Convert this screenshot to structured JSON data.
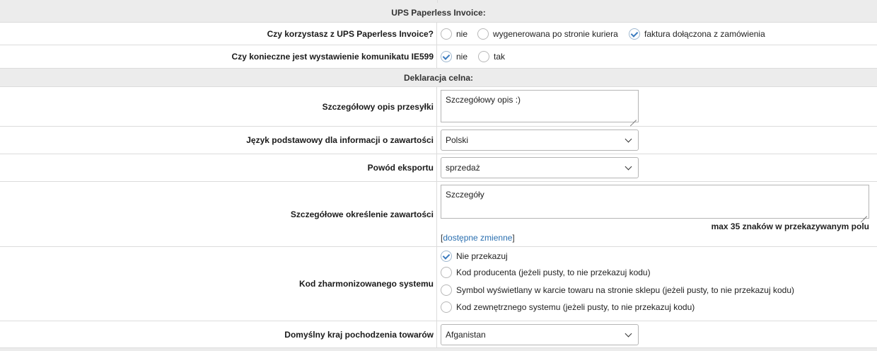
{
  "sections": {
    "ups_paperless": "UPS Paperless Invoice:",
    "customs": "Deklaracja celna:"
  },
  "paperless_invoice": {
    "label": "Czy korzystasz z UPS Paperless Invoice?",
    "options": [
      "nie",
      "wygenerowana po stronie kuriera",
      "faktura dołączona z zamówienia"
    ],
    "selected": "faktura dołączona z zamówienia"
  },
  "ie599": {
    "label": "Czy konieczne jest wystawienie komunikatu IE599",
    "options": [
      "nie",
      "tak"
    ],
    "selected": "nie"
  },
  "shipment_description": {
    "label": "Szczegółowy opis przesyłki",
    "value": "Szczegółowy opis :)"
  },
  "language": {
    "label": "Język podstawowy dla informacji o zawartości",
    "value": "Polski"
  },
  "export_reason": {
    "label": "Powód eksportu",
    "value": "sprzedaż"
  },
  "content_details": {
    "label": "Szczegółowe określenie zawartości",
    "value": "Szczegóły",
    "hint": "max 35 znaków w przekazywanym polu",
    "vars_open": "[",
    "vars_link": "dostępne zmienne",
    "vars_close": "]"
  },
  "hs_code": {
    "label": "Kod zharmonizowanego systemu",
    "options": [
      "Nie przekazuj",
      "Kod producenta (jeżeli pusty, to nie przekazuj kodu)",
      "Symbol wyświetlany w karcie towaru na stronie sklepu (jeżeli pusty, to nie przekazuj kodu)",
      "Kod zewnętrznego systemu (jeżeli pusty, to nie przekazuj kodu)"
    ],
    "selected": "Nie przekazuj"
  },
  "origin_country": {
    "label": "Domyślny kraj pochodzenia towarów",
    "value": "Afganistan"
  },
  "colors": {
    "header_bg": "#ececec",
    "border": "#dcdcdc",
    "link": "#2a6fb0",
    "check": "#3b7bbf"
  }
}
